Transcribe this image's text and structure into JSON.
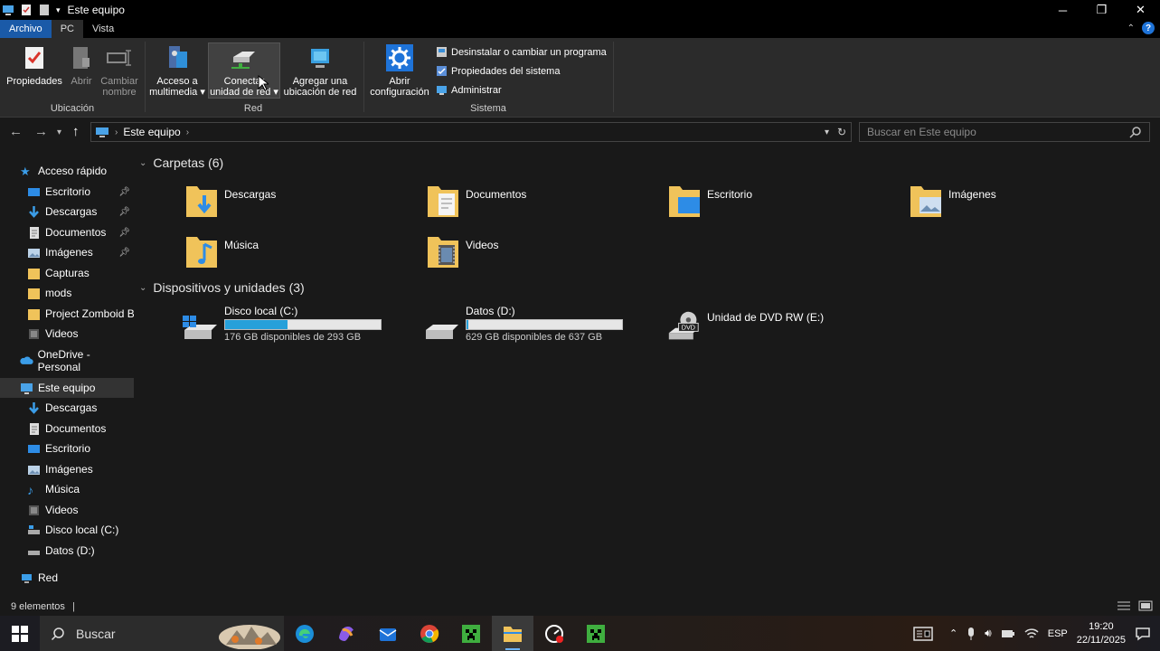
{
  "window": {
    "title": "Este equipo"
  },
  "tabs": [
    "Archivo",
    "PC",
    "Vista"
  ],
  "ribbon": {
    "ubicacion": {
      "label": "Ubicación",
      "buttons": [
        {
          "l1": "Propiedades",
          "l2": ""
        },
        {
          "l1": "Abrir",
          "l2": ""
        },
        {
          "l1": "Cambiar",
          "l2": "nombre"
        }
      ]
    },
    "red": {
      "label": "Red",
      "buttons": [
        {
          "l1": "Acceso a",
          "l2": "multimedia"
        },
        {
          "l1": "Conectar",
          "l2": "unidad de red"
        },
        {
          "l1": "Agregar una",
          "l2": "ubicación de red"
        }
      ]
    },
    "sistema": {
      "label": "Sistema",
      "big": {
        "l1": "Abrir",
        "l2": "configuración"
      },
      "items": [
        "Desinstalar o cambiar un programa",
        "Propiedades del sistema",
        "Administrar"
      ]
    }
  },
  "address": {
    "crumb": "Este equipo",
    "search_placeholder": "Buscar en Este equipo"
  },
  "sidebar": {
    "quick": {
      "label": "Acceso rápido",
      "items": [
        "Escritorio",
        "Descargas",
        "Documentos",
        "Imágenes",
        "Capturas",
        "mods",
        "Project Zomboid Bu",
        "Videos"
      ]
    },
    "onedrive": "OneDrive - Personal",
    "pc": {
      "label": "Este equipo",
      "items": [
        "Descargas",
        "Documentos",
        "Escritorio",
        "Imágenes",
        "Música",
        "Videos",
        "Disco local (C:)",
        "Datos (D:)"
      ]
    },
    "red": "Red"
  },
  "main": {
    "folders_header": "Carpetas (6)",
    "folders": [
      "Descargas",
      "Documentos",
      "Escritorio",
      "Imágenes",
      "Música",
      "Videos"
    ],
    "devices_header": "Dispositivos y unidades (3)",
    "drives": [
      {
        "name": "Disco local (C:)",
        "free": "176 GB disponibles de 293 GB",
        "used_fraction": 0.4
      },
      {
        "name": "Datos (D:)",
        "free": "629 GB disponibles de 637 GB",
        "used_fraction": 0.013
      }
    ],
    "dvd": {
      "name": "Unidad de DVD RW (E:)",
      "badge": "DVD"
    }
  },
  "status": {
    "count": "9 elementos"
  },
  "taskbar": {
    "search": "Buscar",
    "lang": "ESP",
    "time": "19:20",
    "date": "22/11/2025"
  },
  "colors": {
    "folder": "#f0c35a",
    "accent": "#26a0da",
    "file_tab": "#1a5aa8"
  }
}
